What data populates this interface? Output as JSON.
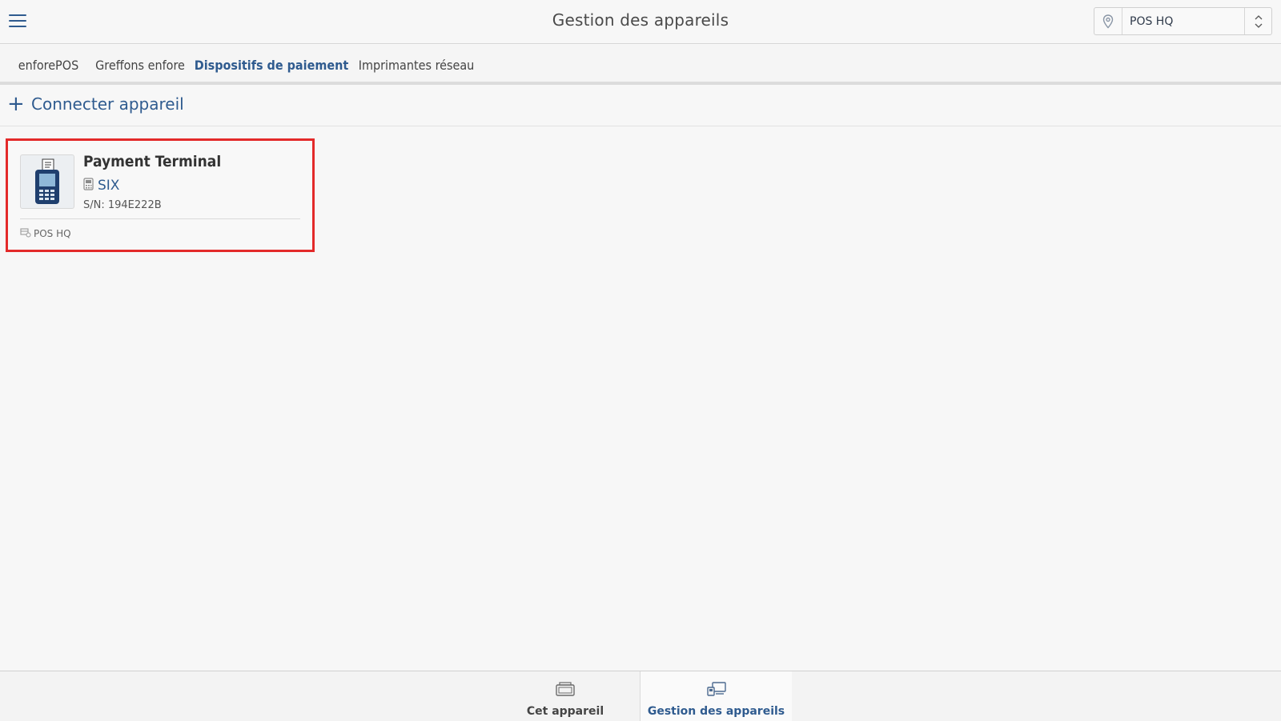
{
  "header": {
    "title": "Gestion des appareils",
    "location": "POS HQ"
  },
  "tabs": [
    {
      "label": "enforePOS",
      "active": false
    },
    {
      "label": "Greffons enfore",
      "active": false
    },
    {
      "label": "Dispositifs de paiement",
      "active": true
    },
    {
      "label": "Imprimantes réseau",
      "active": false
    }
  ],
  "actions": {
    "connect_label": "Connecter appareil"
  },
  "devices": [
    {
      "name": "Payment Terminal",
      "brand": "SIX",
      "serial": "S/N: 194E222B",
      "location": "POS HQ"
    }
  ],
  "bottom_nav": [
    {
      "label": "Cet appareil",
      "icon": "device-icon",
      "active": false
    },
    {
      "label": "Gestion des appareils",
      "icon": "devices-management-icon",
      "active": true
    }
  ],
  "colors": {
    "accent": "#2f5b8f",
    "highlight_border": "#e32a2a",
    "background": "#f7f7f7"
  }
}
